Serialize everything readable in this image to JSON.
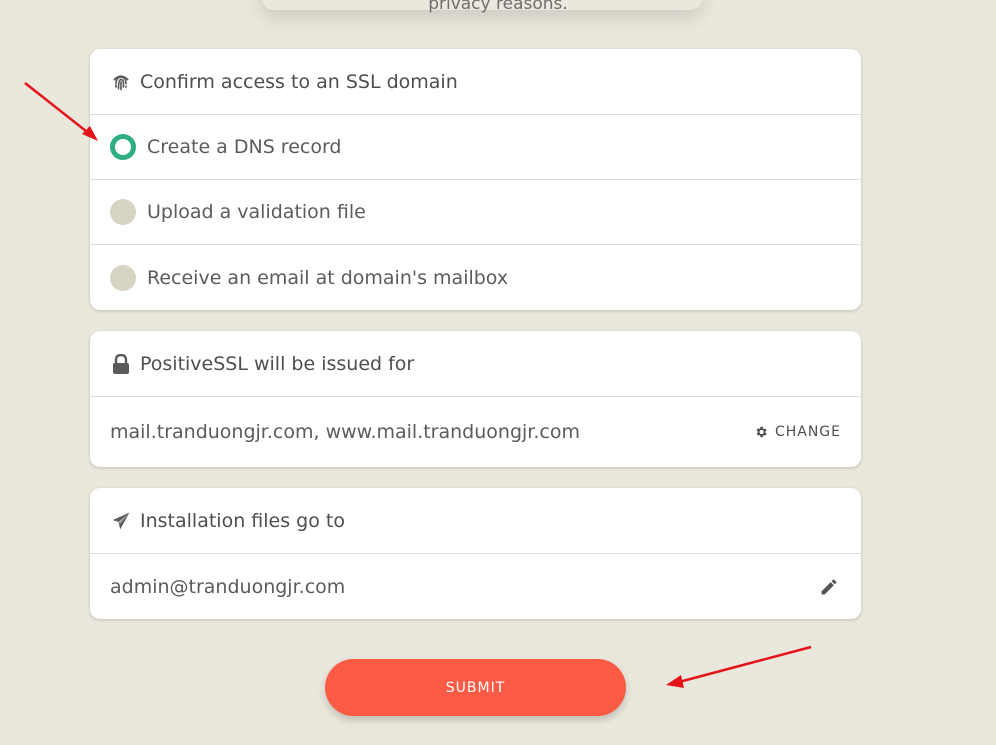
{
  "top": {
    "partial_text": "privacy reasons."
  },
  "dcv": {
    "title": "Confirm access to an SSL domain",
    "options": [
      {
        "label": "Create a DNS record",
        "selected": true
      },
      {
        "label": "Upload a validation file",
        "selected": false
      },
      {
        "label": "Receive an email at domain's mailbox",
        "selected": false
      }
    ]
  },
  "issued": {
    "title": "PositiveSSL will be issued for",
    "domains": "mail.tranduongjr.com, www.mail.tranduongjr.com",
    "change_label": "CHANGE"
  },
  "install": {
    "title": "Installation files go to",
    "email": "admin@tranduongjr.com"
  },
  "submit_label": "SUBMIT",
  "colors": {
    "accent": "#2fae86",
    "submit": "#fb5a44",
    "background": "#eae7dc",
    "annotation": "#e4141a"
  }
}
